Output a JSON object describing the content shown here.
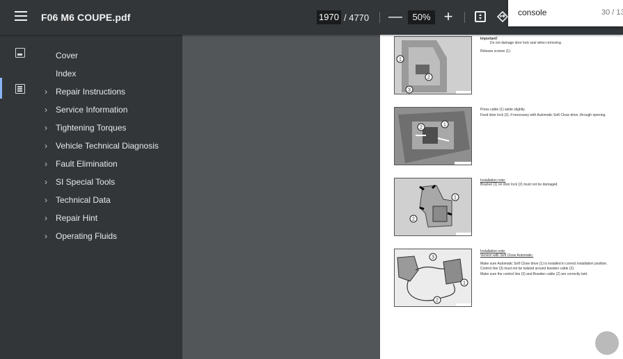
{
  "toolbar": {
    "file_title": "F06 M6 COUPE.pdf",
    "current_page": "1970",
    "total_pages": "/ 4770",
    "zoom_out_symbol": "—",
    "zoom_level": "50%",
    "zoom_in_symbol": "+"
  },
  "find": {
    "query": "console",
    "result_count": "30 / 13"
  },
  "outline": [
    {
      "label": "Cover",
      "expandable": false
    },
    {
      "label": "Index",
      "expandable": false
    },
    {
      "label": "Repair Instructions",
      "expandable": true
    },
    {
      "label": "Service Information",
      "expandable": true
    },
    {
      "label": "Tightening Torques",
      "expandable": true
    },
    {
      "label": "Vehicle Technical Diagnosis",
      "expandable": true
    },
    {
      "label": "Fault Elimination",
      "expandable": true
    },
    {
      "label": "SI Special Tools",
      "expandable": true
    },
    {
      "label": "Technical Data",
      "expandable": true
    },
    {
      "label": "Repair Hint",
      "expandable": true
    },
    {
      "label": "Operating Fluids",
      "expandable": true
    }
  ],
  "document": {
    "block1_heading": "Important!",
    "block1_line1": "Do not damage door lock seal when removing.",
    "block1_line2": "Release screws (1).",
    "block2_line1": "Press cable (1) aside slightly.",
    "block2_line2": "Feed door lock (2), if necessary with Automatic Soft Close drive, through opening.",
    "block3_heading": "Installation note:",
    "block3_line1": "Bracket (1) on door lock (2) must not be damaged.",
    "block4_heading": "Installation note:",
    "block4_sub": "Version with Soft Close Automatic:",
    "block4_line1": "Make sure Automatic Soft Close drive (1) is installed in correct installation position. Control line (3) must not be twisted around bowden cable (2).",
    "block4_line2": "Make sure the control line (3) and Bowden cable (2) are correctly laid."
  }
}
